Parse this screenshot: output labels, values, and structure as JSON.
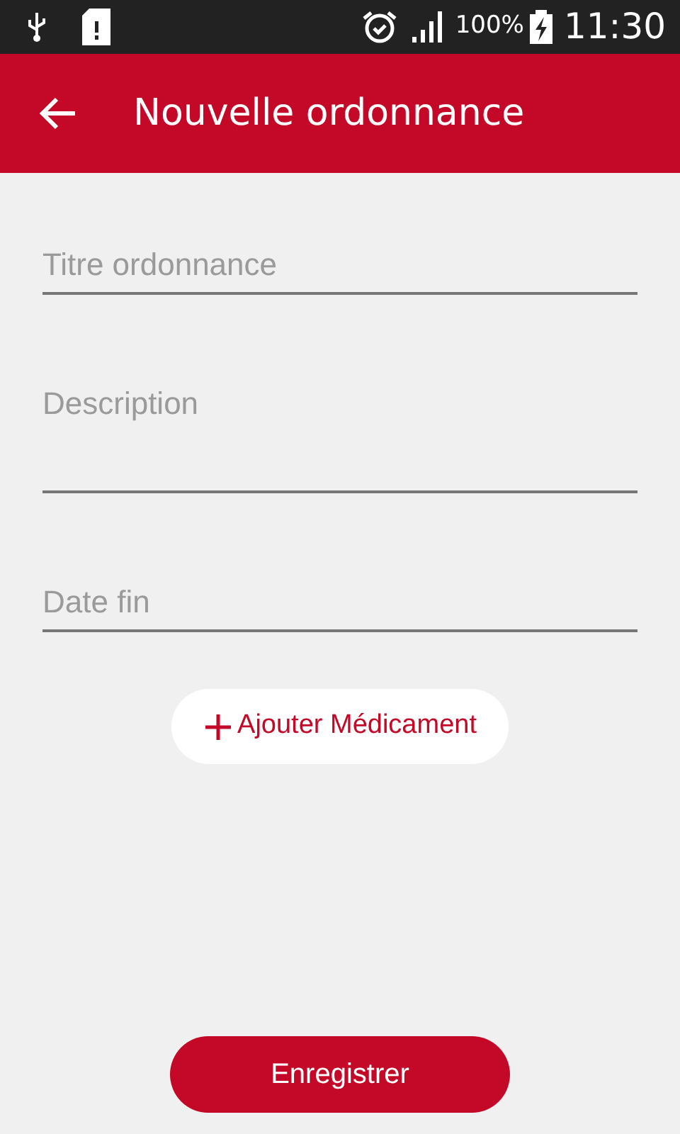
{
  "status_bar": {
    "battery": "100%",
    "time": "11:30"
  },
  "app_bar": {
    "title": "Nouvelle ordonnance"
  },
  "fields": [
    {
      "placeholder": "Titre ordonnance",
      "kind": "single"
    },
    {
      "placeholder": "Description",
      "kind": "multi"
    },
    {
      "placeholder": "Date fin",
      "kind": "single"
    }
  ],
  "add_button": {
    "label": "Ajouter Médicament"
  },
  "save_button": {
    "label": "Enregistrer"
  }
}
